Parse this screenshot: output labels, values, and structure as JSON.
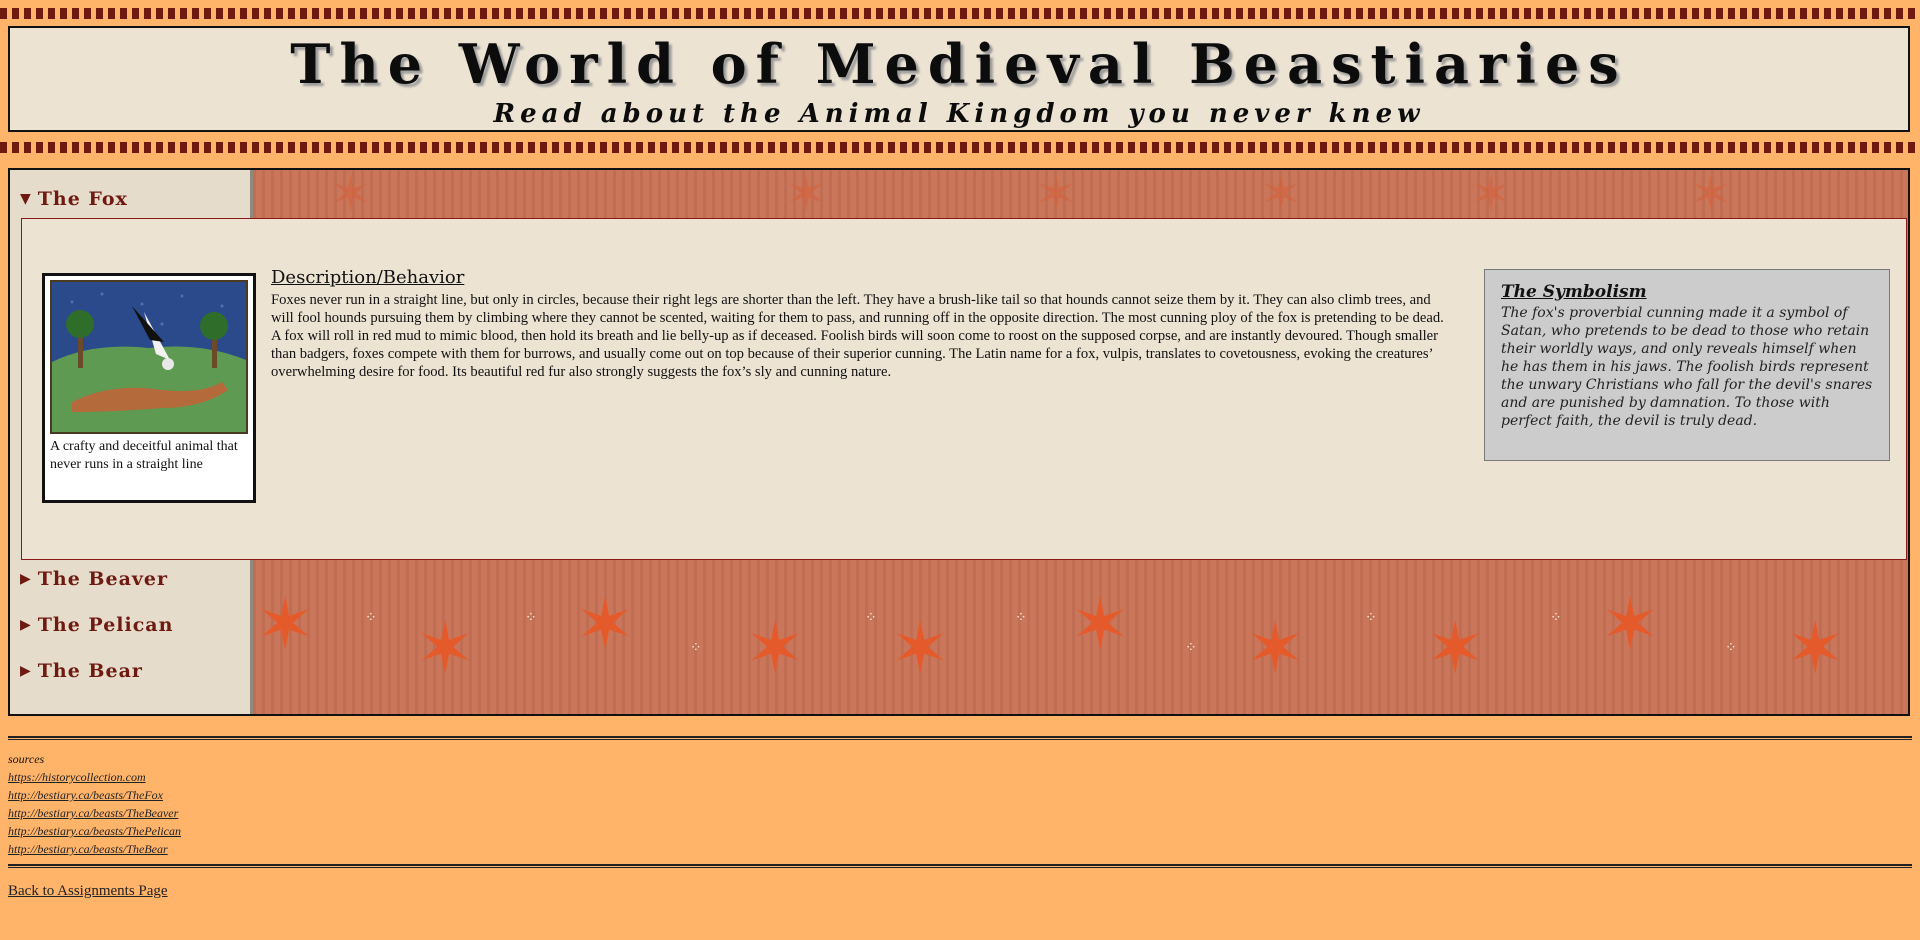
{
  "header": {
    "title": "The World of Medieval Beastiaries",
    "subtitle": "Read about the Animal Kingdom you never knew"
  },
  "beasts": [
    {
      "label": "The Fox",
      "open": true
    },
    {
      "label": "The Beaver",
      "open": false
    },
    {
      "label": "The Pelican",
      "open": false
    },
    {
      "label": "The Bear",
      "open": false
    }
  ],
  "fox": {
    "image_caption": "A crafty and deceitful animal that never runs in a straight line",
    "description_heading": "Description/Behavior",
    "description": "Foxes never run in a straight line, but only in circles, because their right legs are shorter than the left. They have a brush-like tail so that hounds cannot seize them by it. They can also climb trees, and will fool hounds pursuing them by climbing where they cannot be scented, waiting for them to pass, and running off in the opposite direction. The most cunning ploy of the fox is pretending to be dead. A fox will roll in red mud to mimic blood, then hold its breath and lie belly-up as if deceased. Foolish birds will soon come to roost on the supposed corpse, and are instantly devoured. Though smaller than badgers, foxes compete with them for burrows, and usually come out on top because of their superior cunning. The Latin name for a fox, vulpis, translates to covetousness, evoking the creatures’ overwhelming desire for food. Its beautiful red fur also strongly suggests the fox’s sly and cunning nature.",
    "symbolism_heading": "The Symbolism",
    "symbolism": "The fox's proverbial cunning made it a symbol of Satan, who pretends to be dead to those who retain their worldly ways, and only reveals himself when he has them in his jaws. The foolish birds represent the unwary Christians who fall for the devil's snares and are punished by damnation. To those with perfect faith, the devil is truly dead."
  },
  "sources": {
    "label": "sources",
    "links": [
      "https://historycollection.com",
      "http://bestiary.ca/beasts/TheFox",
      "http://bestiary.ca/beasts/TheBeaver",
      "http://bestiary.ca/beasts/ThePelican",
      "http://bestiary.ca/beasts/TheBear"
    ]
  },
  "back_link": "Back to Assignments Page",
  "colors": {
    "page": "#ffb46a",
    "parchment": "#ece3d3",
    "accent_dark_red": "#6e1a10",
    "fresco": "#c77256",
    "star": "#e55a2a"
  },
  "icons": {
    "open": "triangle-down-icon",
    "closed": "triangle-right-icon"
  }
}
